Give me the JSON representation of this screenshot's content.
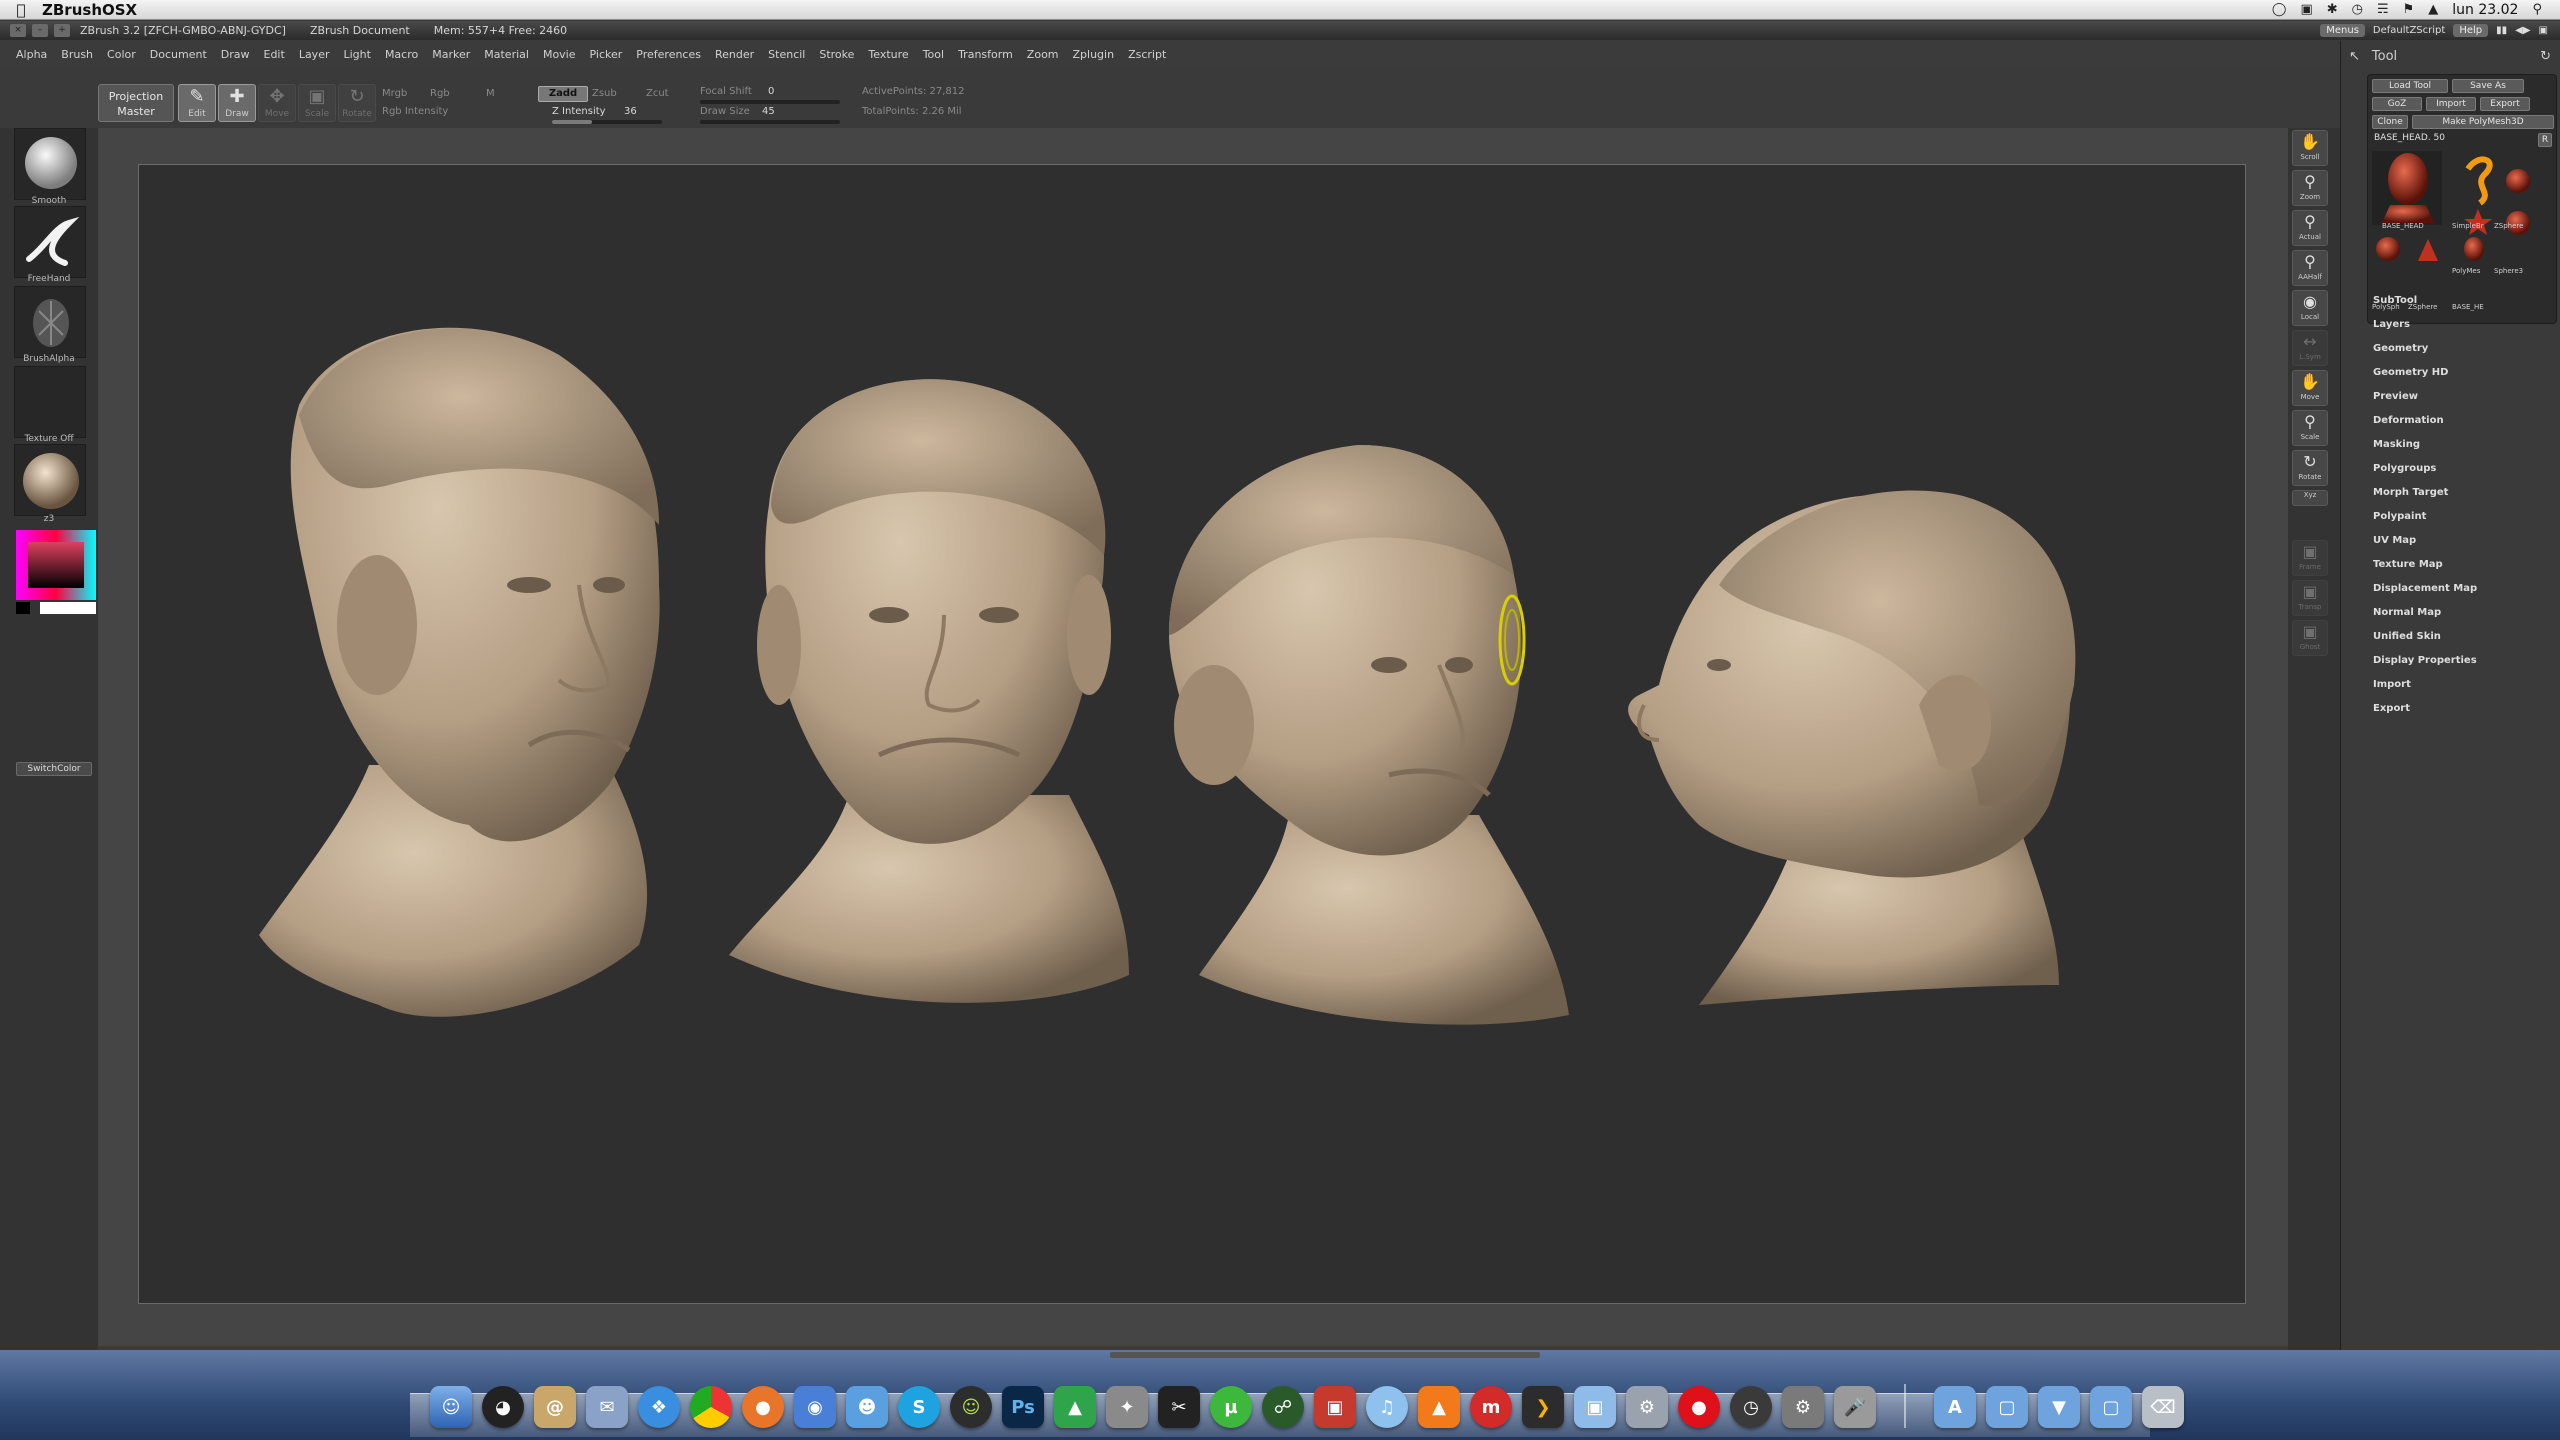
{
  "macbar": {
    "app_name": "ZBrushOSX",
    "clock": "lun 23.02"
  },
  "zb_titlebar": {
    "version": "ZBrush 3.2 [ZFCH-GMBO-ABNJ-GYDC]",
    "document": "ZBrush Document",
    "mem": "Mem: 557+4  Free: 2460",
    "menus_label": "Menus",
    "script_label": "DefaultZScript",
    "help_label": "Help"
  },
  "menu": {
    "items": [
      "Alpha",
      "Brush",
      "Color",
      "Document",
      "Draw",
      "Edit",
      "Layer",
      "Light",
      "Macro",
      "Marker",
      "Material",
      "Movie",
      "Picker",
      "Preferences",
      "Render",
      "Stencil",
      "Stroke",
      "Texture",
      "Tool",
      "Transform",
      "Zoom",
      "Zplugin",
      "Zscript"
    ]
  },
  "shelf": {
    "projection_master": "Projection Master",
    "edit": "Edit",
    "draw": "Draw",
    "move": "Move",
    "scale": "Scale",
    "rotate": "Rotate",
    "mrgb": "Mrgb",
    "rgb": "Rgb",
    "m": "M",
    "rgb_intensity": "Rgb Intensity",
    "zadd": "Zadd",
    "zsub": "Zsub",
    "zcut": "Zcut",
    "z_intensity_label": "Z Intensity",
    "z_intensity_value": "36",
    "z_intensity_level": 0.36,
    "focal_shift_label": "Focal Shift",
    "focal_shift_value": "0",
    "draw_size_label": "Draw Size",
    "draw_size_value": "45",
    "active_points": "ActivePoints: 27,812",
    "total_points": "TotalPoints: 2.26 Mil"
  },
  "left_palette": {
    "smooth": "Smooth",
    "freehand": "FreeHand",
    "brush_alpha": "BrushAlpha",
    "texture_off": "Texture Off",
    "material": "z3",
    "switch_color": "SwitchColor"
  },
  "right_shelf": {
    "buttons": [
      "Scroll",
      "Zoom",
      "Actual",
      "AAHalf",
      "Local",
      "L.Sym",
      "Move",
      "Scale",
      "Rotate",
      "Xyz",
      "Frame",
      "Transp",
      "Ghost"
    ]
  },
  "tool_panel": {
    "title": "Tool",
    "load_tool": "Load Tool",
    "save_as": "Save As",
    "goz": "GoZ",
    "import": "Import",
    "export": "Export",
    "clone": "Clone",
    "make_polymesh": "Make PolyMesh3D",
    "current_tool": "BASE_HEAD. 50",
    "r": "R",
    "thumbs": [
      "BASE_HEAD",
      "SimpleBr",
      "ZSphere",
      "PolyMes",
      "Sphere3",
      "PolySph",
      "ZSphere",
      "BASE_HE"
    ],
    "sections": [
      "SubTool",
      "Layers",
      "Geometry",
      "Geometry HD",
      "Preview",
      "Deformation",
      "Masking",
      "Polygroups",
      "Morph Target",
      "Polypaint",
      "UV Map",
      "Texture Map",
      "Displacement Map",
      "Normal Map",
      "Unified Skin",
      "Display Properties",
      "Import",
      "Export"
    ]
  },
  "colors": {
    "canvas_bg": "#2f2f2f",
    "sculpt": "#bba78f",
    "brush_cursor": "#d8d000"
  },
  "dock": {
    "icons": [
      "Finder",
      "Dashboard",
      "Address Book",
      "Mail",
      "Safari",
      "Chrome",
      "Firefox",
      "iChat",
      "Contacts",
      "Skype",
      "Adium",
      "Photoshop",
      "Sketchup",
      "Instruments",
      "Final Cut",
      "uTorrent",
      "Transmission",
      "Photo Booth",
      "iTunes",
      "VLC",
      "Miro",
      "Plex",
      "Preview",
      "Automator",
      "Vodafone",
      "Time Machine",
      "System Preferences",
      "Microphone",
      "Applications",
      "Documents",
      "Downloads",
      "Folder",
      "Trash"
    ]
  }
}
